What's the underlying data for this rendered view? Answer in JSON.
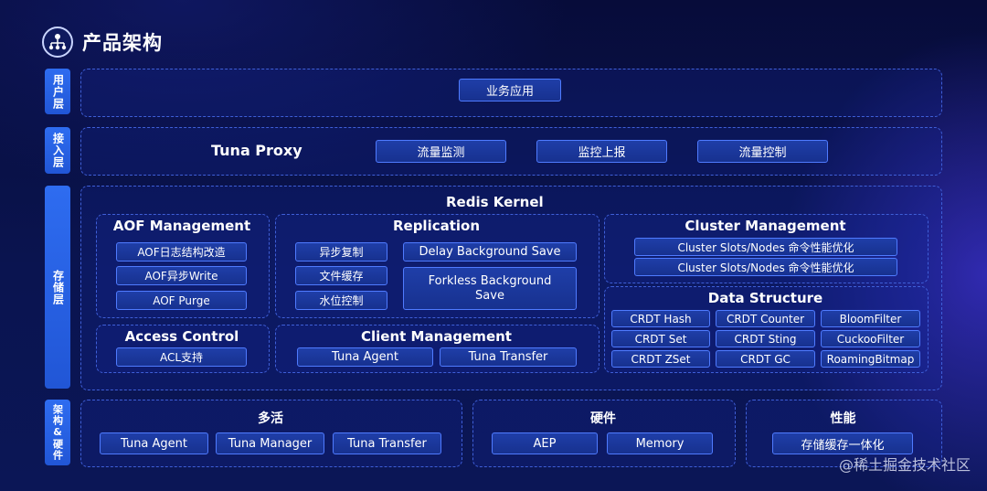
{
  "title": "产品架构",
  "layers": {
    "user": "用户层",
    "access": "接入层",
    "storage": "存储层",
    "arch": "架构&硬件"
  },
  "user_layer": {
    "app": "业务应用"
  },
  "access_layer": {
    "proxy": "Tuna Proxy",
    "items": [
      "流量监测",
      "监控上报",
      "流量控制"
    ]
  },
  "kernel": {
    "title": "Redis Kernel",
    "aof": {
      "title": "AOF Management",
      "items": [
        "AOF日志结构改造",
        "AOF异步Write",
        "AOF Purge"
      ]
    },
    "replication": {
      "title": "Replication",
      "left": [
        "异步复制",
        "文件缓存",
        "水位控制"
      ],
      "delay": "Delay Background Save",
      "forkless": "Forkless Background Save"
    },
    "cluster": {
      "title": "Cluster Management",
      "items": [
        "Cluster Slots/Nodes 命令性能优化",
        "Cluster Slots/Nodes 命令性能优化"
      ]
    },
    "access_control": {
      "title": "Access Control",
      "item": "ACL支持"
    },
    "client": {
      "title": "Client Management",
      "items": [
        "Tuna Agent",
        "Tuna Transfer"
      ]
    },
    "data_structure": {
      "title": "Data Structure",
      "items": [
        "CRDT Hash",
        "CRDT Counter",
        "BloomFilter",
        "CRDT Set",
        "CRDT Sting",
        "CuckooFilter",
        "CRDT ZSet",
        "CRDT GC",
        "RoamingBitmap"
      ]
    }
  },
  "hardware": {
    "multi": {
      "title": "多活",
      "items": [
        "Tuna Agent",
        "Tuna Manager",
        "Tuna Transfer"
      ]
    },
    "hw": {
      "title": "硬件",
      "items": [
        "AEP",
        "Memory"
      ]
    },
    "perf": {
      "title": "性能",
      "items": [
        "存储缓存一体化"
      ]
    }
  },
  "watermark": "@稀土掘金技术社区"
}
